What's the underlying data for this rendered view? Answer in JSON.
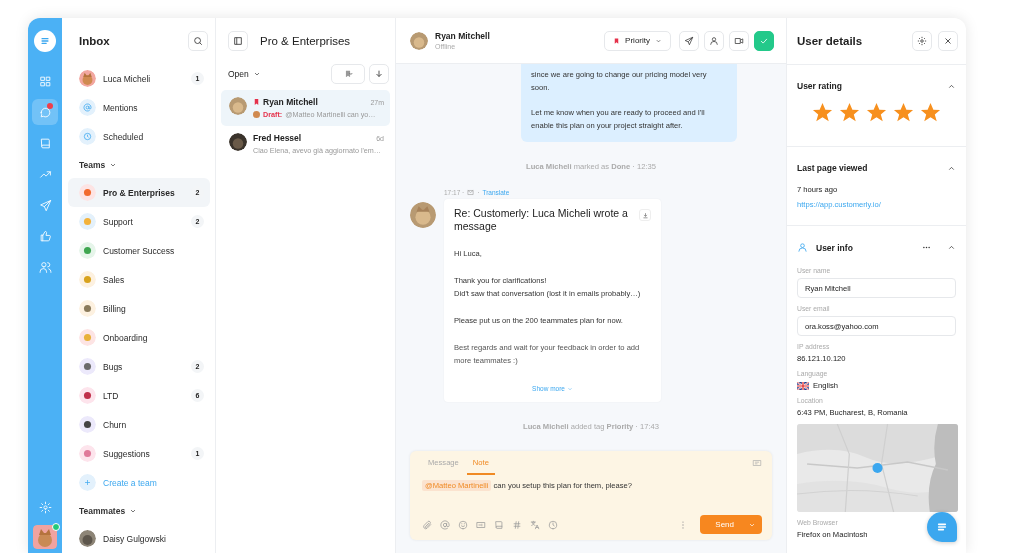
{
  "rail": {
    "items": [
      {
        "selected": false,
        "unread": false
      },
      {
        "selected": true,
        "unread": true
      },
      {
        "selected": false,
        "unread": false
      },
      {
        "selected": false,
        "unread": false
      },
      {
        "selected": false,
        "unread": false
      },
      {
        "selected": false,
        "unread": false
      },
      {
        "selected": false,
        "unread": false
      }
    ]
  },
  "inbox": {
    "title": "Inbox",
    "items": [
      {
        "kind": "avatar",
        "label": "Luca Micheli",
        "count": "1"
      },
      {
        "kind": "mention",
        "label": "Mentions"
      },
      {
        "kind": "clock",
        "label": "Scheduled"
      }
    ],
    "teams_heading": "Teams",
    "teams": [
      {
        "label": "Pro & Enterprises",
        "count": "2",
        "selected": true
      },
      {
        "label": "Support",
        "count": "2",
        "selected": false
      },
      {
        "label": "Customer Success",
        "selected": false
      },
      {
        "label": "Sales",
        "selected": false
      },
      {
        "label": "Billing",
        "selected": false
      },
      {
        "label": "Onboarding",
        "selected": false
      },
      {
        "label": "Bugs",
        "count": "2",
        "selected": false
      },
      {
        "label": "LTD",
        "count": "6",
        "selected": false
      },
      {
        "label": "Churn",
        "selected": false
      },
      {
        "label": "Suggestions",
        "count": "1",
        "selected": false
      }
    ],
    "create_team": "Create a team",
    "teammates_heading": "Teammates",
    "teammates": [
      {
        "label": "Daisy Gulgowski"
      }
    ]
  },
  "conversations": {
    "title": "Pro & Enterprises",
    "filter": "Open",
    "items": [
      {
        "name": "Ryan Mitchell",
        "time": "27m",
        "flagged": true,
        "draft": "Draft:",
        "preview": "@Matteo Martinelli can yo…",
        "selected": true
      },
      {
        "name": "Fred Hessel",
        "time": "6d",
        "flagged": false,
        "preview": "Ciao Elena, avevo già aggiornato l'em…",
        "selected": false
      }
    ]
  },
  "chat": {
    "contact": {
      "name": "Ryan Mitchell",
      "status": "Offline"
    },
    "tag_button": "Priority",
    "messages": [
      {
        "kind": "outgoing",
        "paragraphs": [
          "since we are going to change our pricing model very soon.",
          "Let me know when you are ready to proceed and I'll enable this plan on your project straight after."
        ]
      },
      {
        "kind": "event",
        "text": "**Luca Micheli** marked as **Done** · 12:35"
      },
      {
        "kind": "email",
        "time": "17:17 ·",
        "separator": "·",
        "translate": "Translate",
        "subject": "Re: Customerly: Luca Micheli wrote a message",
        "paragraphs": [
          "Hi Luca,",
          "Thank you for clarifications!\nDid't saw that conversation (lost it in emails probably…)",
          "Please put us on the 200 teammates plan for now.",
          "Best regards and wait for your feedback in order to add more teammates :)"
        ],
        "show_more": "Show more"
      },
      {
        "kind": "event",
        "text": "**Luca Micheli** added tag **Priority** · 17:43"
      }
    ],
    "composer": {
      "tabs": [
        {
          "label": "Message",
          "selected": false
        },
        {
          "label": "Note",
          "selected": true
        }
      ],
      "mention": "@Matteo Martinelli",
      "text": "can you setup this plan for them, please?",
      "send": "Send"
    }
  },
  "details": {
    "title": "User details",
    "rating": {
      "title": "User rating",
      "expanded": true,
      "stars": 5
    },
    "last_page": {
      "title": "Last page viewed",
      "expanded": true,
      "time": "7 hours ago",
      "url": "https://app.customerly.io/"
    },
    "user_info": {
      "title": "User info",
      "expanded": true,
      "fields": [
        {
          "kind": "input",
          "label": "User name",
          "value": "Ryan Mitchell"
        },
        {
          "kind": "input",
          "label": "User email",
          "value": "ora.koss@yahoo.com"
        },
        {
          "kind": "text",
          "label": "IP address",
          "value": "86.121.10.120"
        },
        {
          "kind": "flag",
          "label": "Language",
          "value": "English"
        },
        {
          "kind": "text",
          "label": "Location",
          "value": "6:43 PM, Bucharest, B, Romania"
        },
        {
          "kind": "map"
        },
        {
          "kind": "text",
          "label": "Web Browser",
          "value": "Firefox on Macintosh"
        }
      ]
    }
  }
}
